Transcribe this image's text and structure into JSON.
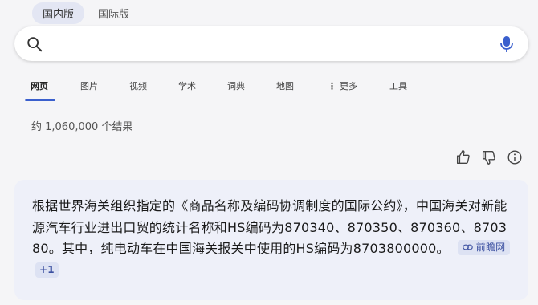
{
  "region_tabs": [
    {
      "label": "国内版",
      "active": true
    },
    {
      "label": "国际版",
      "active": false
    }
  ],
  "search": {
    "value": "",
    "placeholder": ""
  },
  "nav_tabs": {
    "web": "网页",
    "images": "图片",
    "videos": "视频",
    "academic": "学术",
    "dictionary": "词典",
    "maps": "地图",
    "more": "更多",
    "tools": "工具"
  },
  "result_count": "约 1,060,000 个结果",
  "answer": {
    "text": "根据世界海关组织指定的《商品名称及编码协调制度的国际公约》，中国海关对新能源汽车行业进出口贸的统计名称和HS编码为870340、870350、870360、870380。其中，纯电动车在中国海关报关中使用的HS编码为8703800000。",
    "citation_label": "前瞻网",
    "citation_more": "+1"
  },
  "icons": {
    "search": "search-icon",
    "mic": "mic-icon",
    "more": "more-dots-icon",
    "like": "thumbs-up-icon",
    "dislike": "thumbs-down-icon",
    "info": "info-icon",
    "link": "link-icon"
  },
  "colors": {
    "accent": "#3a5fcd",
    "card_bg": "#eef0f9",
    "chip_bg": "#dde2f3"
  }
}
